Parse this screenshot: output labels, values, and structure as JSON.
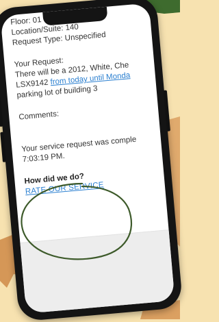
{
  "request": {
    "floor": "Floor: 01",
    "location": "Location/Suite: 140",
    "type": "Request Type: Unspecified",
    "your_request_label": "Your Request:",
    "line1": "There will be a 2012, White, Che",
    "line2_plate": "LSX9142 ",
    "line2_link": "from today until Monda",
    "line3": "parking lot of building 3",
    "comments_label": "Comments:",
    "status_line1": "Your service request was comple",
    "status_line2": "7:03:19 PM."
  },
  "feedback": {
    "question": "How did we do?",
    "rate_link": "RATE OUR SERVICE"
  },
  "colors": {
    "background": "#f7e2b0",
    "leaf": "#d9924a",
    "link": "#2a7fd0",
    "circle": "#3d5a2a"
  }
}
